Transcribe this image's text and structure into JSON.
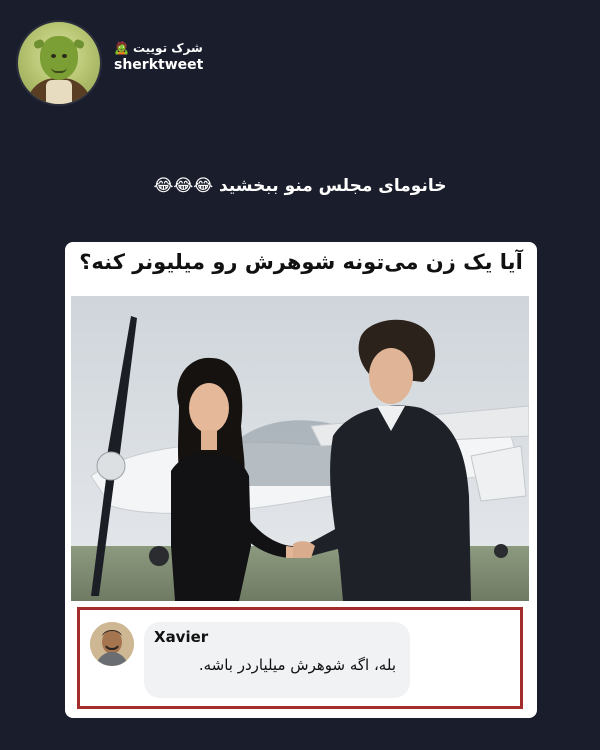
{
  "header": {
    "display_name": "شرک توییت",
    "display_name_emoji": "🧟",
    "handle": "sherktweet",
    "avatar_icon": "shrek-avatar-icon"
  },
  "post": {
    "caption": "خانومای مجلس منو ببخشید 😂😂😂"
  },
  "meme": {
    "title": "آیا یک زن می‌تونه شوهرش رو میلیونر کنه؟",
    "photo_icon": "couple-handshake-airplane-photo",
    "comment": {
      "name": "Xavier",
      "text": "بله، اگه شوهرش میلیاردر باشه.",
      "avatar_icon": "commenter-avatar-icon"
    }
  },
  "colors": {
    "background": "#1a1d2b",
    "card": "#ffffff",
    "comment_border": "#a42c2c",
    "bubble": "#f1f2f4"
  }
}
